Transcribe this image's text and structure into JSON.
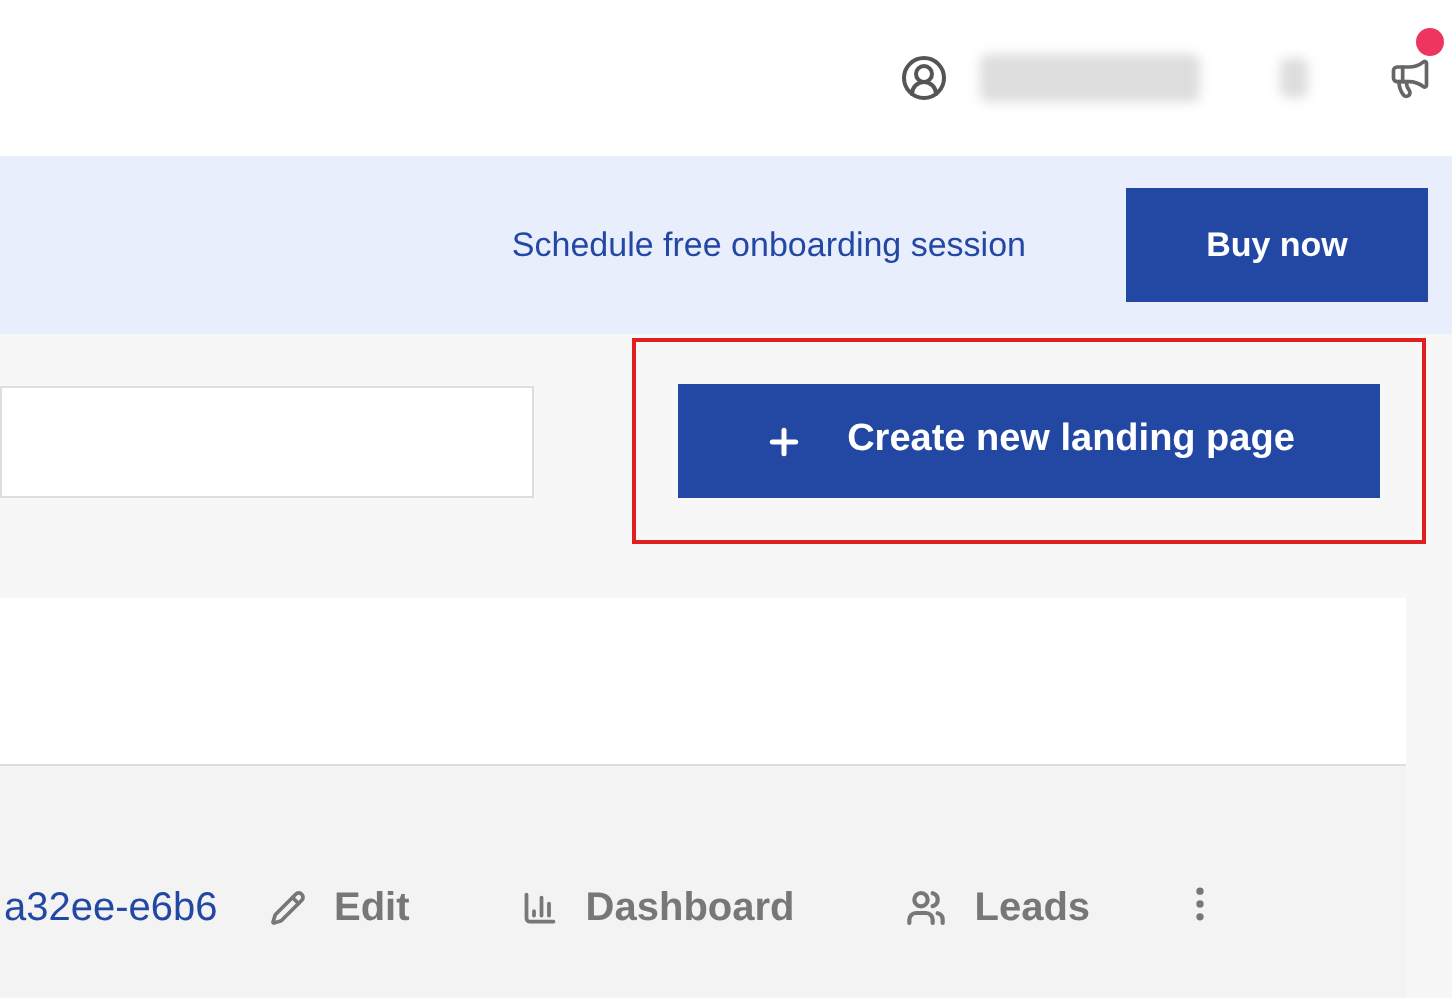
{
  "header": {
    "notification_badge": true
  },
  "banner": {
    "link": "Schedule free onboarding session",
    "button": "Buy now"
  },
  "toolbar": {
    "create_button": "Create new landing page",
    "highlighted": true
  },
  "row": {
    "id_link": "a32ee-e6b6",
    "actions": [
      {
        "kind": "edit",
        "label": "Edit"
      },
      {
        "kind": "dashboard",
        "label": "Dashboard"
      },
      {
        "kind": "leads",
        "label": "Leads"
      }
    ]
  }
}
